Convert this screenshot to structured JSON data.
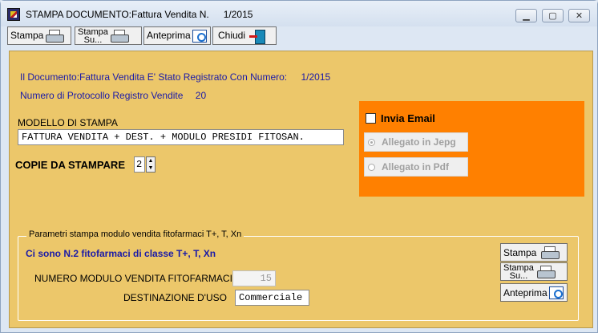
{
  "window": {
    "title": "STAMPA DOCUMENTO:Fattura Vendita N.",
    "doc_number": "1/2015",
    "minimize": "▁",
    "maximize": "▢",
    "close": "✕"
  },
  "toolbar": {
    "print_label": "Stampa",
    "print_on_line1": "Stampa",
    "print_on_line2": "Su...",
    "preview_label": "Anteprima",
    "close_label": "Chiudi"
  },
  "info": {
    "registered_text": "Il Documento:Fattura Vendita E' Stato Registrato Con Numero:",
    "registered_number": "1/2015",
    "protocol_text": "Numero di Protocollo Registro Vendite",
    "protocol_number": "20"
  },
  "model": {
    "label": "MODELLO DI STAMPA",
    "value": "FATTURA VENDITA + DEST. + MODULO PRESIDI FITOSAN."
  },
  "copies": {
    "label": "COPIE DA STAMPARE",
    "value": "2"
  },
  "email": {
    "checkbox_label": "Invia Email",
    "checked": false,
    "option_jpeg": "Allegato in Jepg",
    "option_pdf": "Allegato in Pdf",
    "selected": "jpeg",
    "panel_color": "#ff8000"
  },
  "fito": {
    "group_title": "Parametri stampa modulo vendita fitofarmaci T+, T, Xn",
    "notice": "Ci sono N.2 fitofarmaci di classe T+, T, Xn",
    "module_label": "NUMERO MODULO VENDITA FITOFARMACI",
    "module_value": "15",
    "destination_label": "DESTINAZIONE D'USO",
    "destination_value": "Commerciale",
    "print_label": "Stampa",
    "print_on_line1": "Stampa",
    "print_on_line2": "Su...",
    "preview_label": "Anteprima"
  },
  "colors": {
    "panel_bg": "#ecc76a",
    "info_text": "#1a1aa8"
  }
}
